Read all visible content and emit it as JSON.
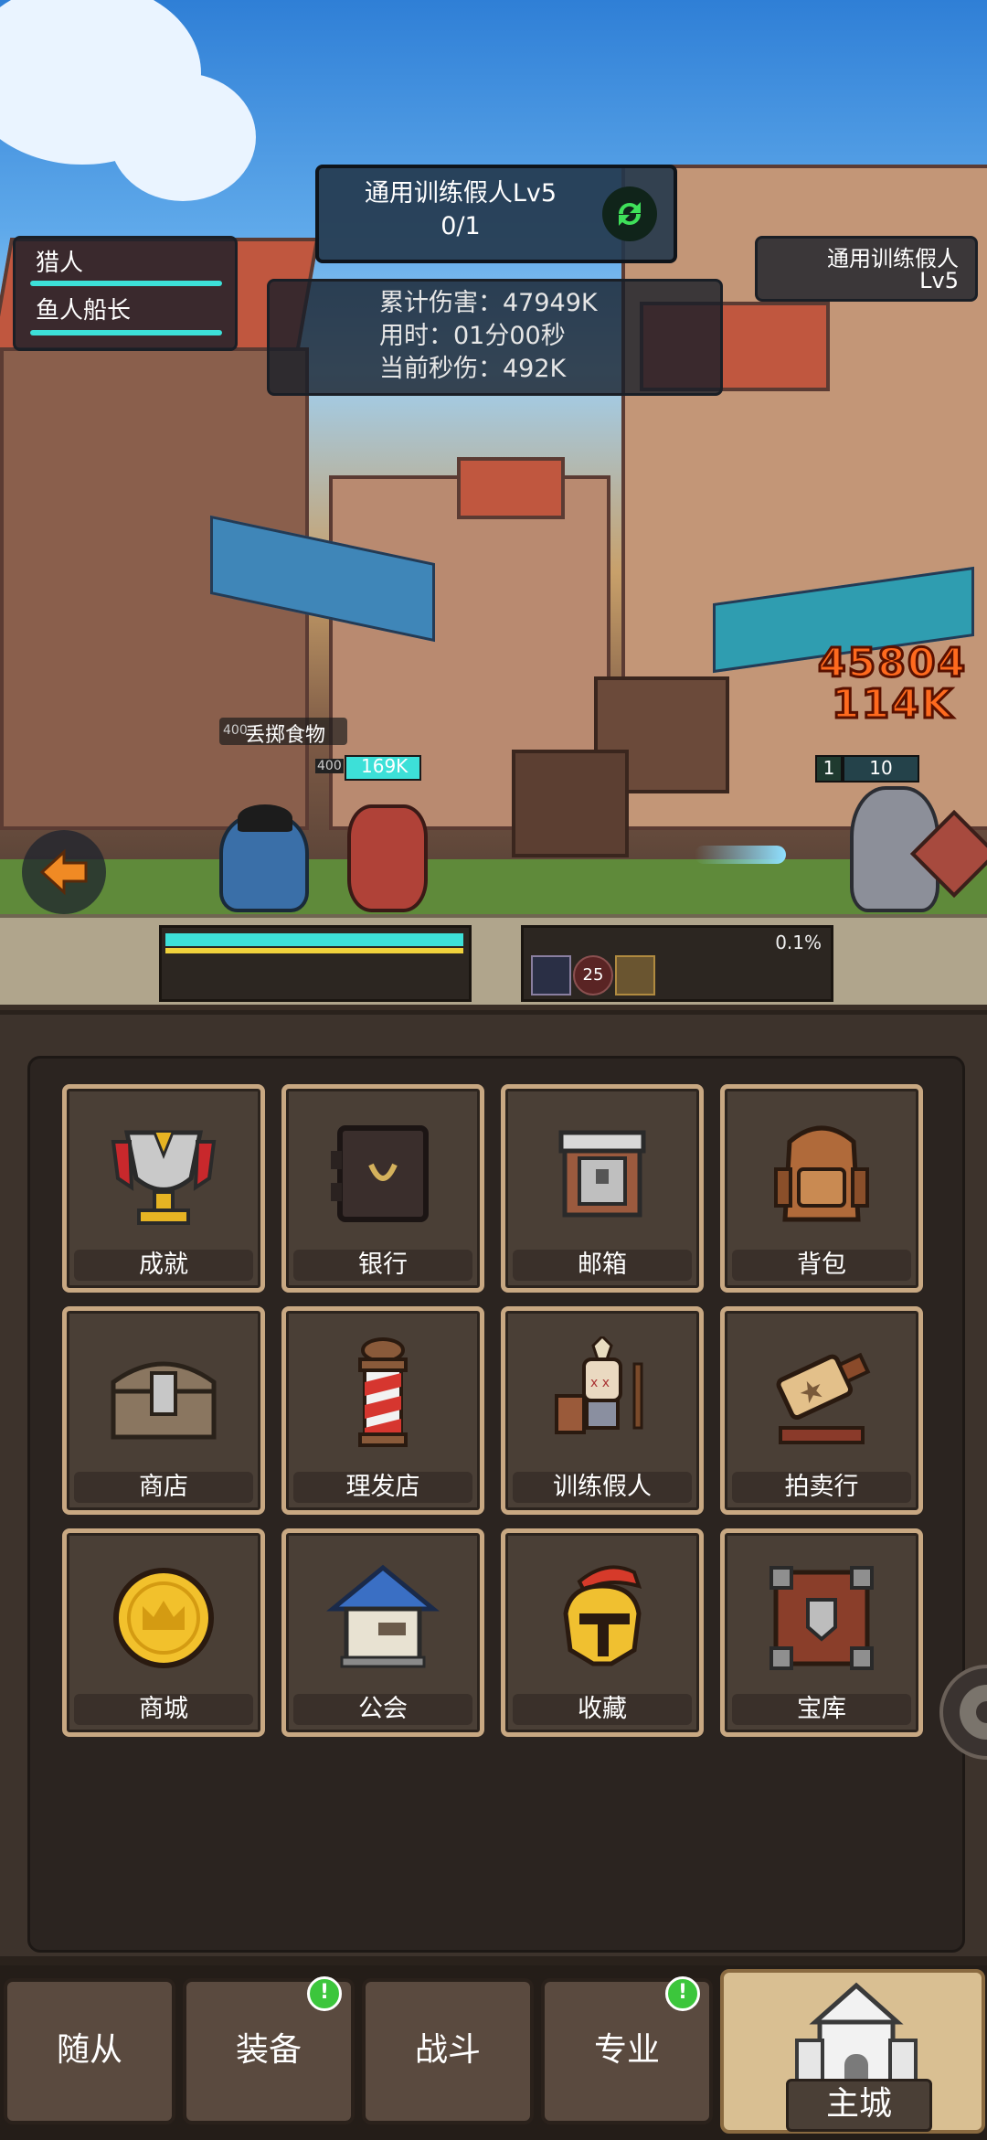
{
  "target": {
    "name": "通用训练假人Lv5",
    "progress": "0/1"
  },
  "party": [
    "猎人",
    "鱼人船长"
  ],
  "stats": {
    "damage": "累计伤害：47949K",
    "time": "用时：01分00秒",
    "dps": "当前秒伤：492K"
  },
  "enemy_label": {
    "name": "通用训练假人",
    "level": "Lv5"
  },
  "floating": {
    "skill": "丢掷食物",
    "player_level": "400",
    "pet_level": "400",
    "player_hp": "169K",
    "dmg1": "45804",
    "dmg2": "114K",
    "enemy_level": "1",
    "enemy_hp": "10"
  },
  "battle_progress": "0.1%",
  "buff_count": "25",
  "menu": [
    {
      "label": "成就",
      "icon": "trophy-icon"
    },
    {
      "label": "银行",
      "icon": "safe-icon"
    },
    {
      "label": "邮箱",
      "icon": "mailbox-icon"
    },
    {
      "label": "背包",
      "icon": "backpack-icon"
    },
    {
      "label": "商店",
      "icon": "chest-icon"
    },
    {
      "label": "理发店",
      "icon": "barber-pole-icon"
    },
    {
      "label": "训练假人",
      "icon": "dummy-icon"
    },
    {
      "label": "拍卖行",
      "icon": "gavel-icon"
    },
    {
      "label": "商城",
      "icon": "coin-icon"
    },
    {
      "label": "公会",
      "icon": "guild-house-icon"
    },
    {
      "label": "收藏",
      "icon": "helmet-icon"
    },
    {
      "label": "宝库",
      "icon": "vault-crate-icon"
    }
  ],
  "nav": [
    {
      "label": "随从",
      "badge": false
    },
    {
      "label": "装备",
      "badge": true
    },
    {
      "label": "战斗",
      "badge": false
    },
    {
      "label": "专业",
      "badge": true
    },
    {
      "label": "主城",
      "badge": false
    }
  ],
  "colors": {
    "hp": "#3de0d8",
    "tile_border": "#c8a882",
    "badge": "#3cc63c",
    "damage_text": "#ff6a1e"
  }
}
